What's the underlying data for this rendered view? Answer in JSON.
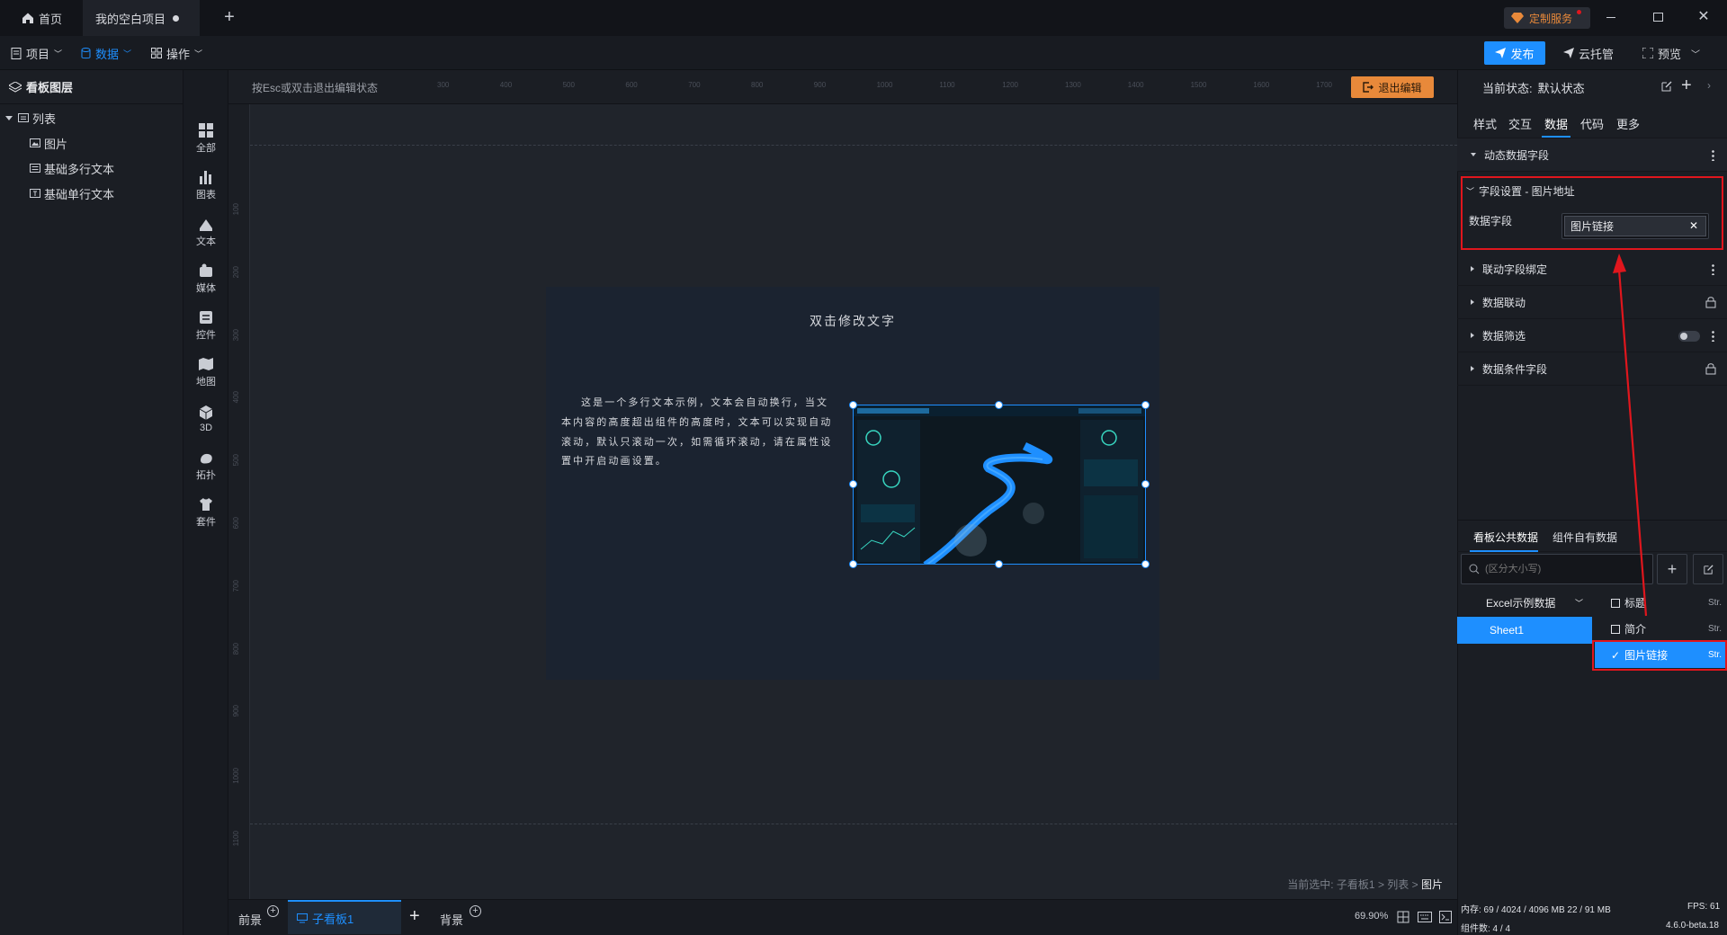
{
  "titlebar": {
    "tabs": [
      {
        "label": "首页"
      },
      {
        "label": "我的空白项目"
      }
    ],
    "custom_service": "定制服务"
  },
  "menubar": {
    "project": "项目",
    "data": "数据",
    "operate": "操作",
    "publish": "发布",
    "cloud": "云托管",
    "preview": "预览"
  },
  "layers": {
    "title": "看板图层",
    "root": "列表",
    "children": [
      "图片",
      "基础多行文本",
      "基础单行文本"
    ]
  },
  "strip": [
    "全部",
    "图表",
    "文本",
    "媒体",
    "控件",
    "地图",
    "3D",
    "拓扑",
    "套件"
  ],
  "canvas": {
    "hint": "按Esc或双击退出编辑状态",
    "exit_edit": "退出编辑",
    "hruler": [
      "300",
      "400",
      "500",
      "600",
      "700",
      "800",
      "900",
      "1000",
      "1100",
      "1200",
      "1300",
      "1400",
      "1500",
      "1600",
      "1700"
    ],
    "vruler": [
      "100",
      "200",
      "300",
      "400",
      "500",
      "600",
      "700",
      "800",
      "900",
      "1000",
      "1100"
    ],
    "title_text": "双击修改文字",
    "body_text": "这是一个多行文本示例，文本会自动换行，当文本内容的高度超出组件的高度时，文本可以实现自动滚动，默认只滚动一次，如需循环滚动，请在属性设置中开启动画设置。",
    "breadcrumb_prefix": "当前选中: 子看板1 > 列表 >",
    "breadcrumb_current": "图片"
  },
  "bottombar": {
    "foreground": "前景",
    "subboard": "子看板1",
    "background": "背景",
    "zoom": "69.90%"
  },
  "right": {
    "state_label": "当前状态:",
    "state_value": "默认状态",
    "tabs": [
      "样式",
      "交互",
      "数据",
      "代码",
      "更多"
    ],
    "active_tab": "数据",
    "sections": {
      "dynamic": "动态数据字段",
      "field_setting": "字段设置 - 图片地址",
      "data_field_label": "数据字段",
      "data_field_value": "图片链接",
      "linked": "联动字段绑定",
      "linkage": "数据联动",
      "filter": "数据筛选",
      "condition": "数据条件字段"
    },
    "data_tabs": [
      "看板公共数据",
      "组件自有数据"
    ],
    "search_placeholder": "(区分大小写)",
    "source": "Excel示例数据",
    "sheet": "Sheet1",
    "fields": [
      {
        "name": "标题",
        "type": "Str."
      },
      {
        "name": "简介",
        "type": "Str."
      },
      {
        "name": "图片链接",
        "type": "Str."
      }
    ],
    "status": {
      "memory": "内存: 69 / 4024 / 4096 MB  22 / 91 MB",
      "fps": "FPS: 61",
      "components": "组件数: 4 / 4",
      "version": "4.6.0-beta.18"
    }
  },
  "colors": {
    "accent": "#1e8fff",
    "red": "#e0161d",
    "orange": "#e8893a"
  }
}
